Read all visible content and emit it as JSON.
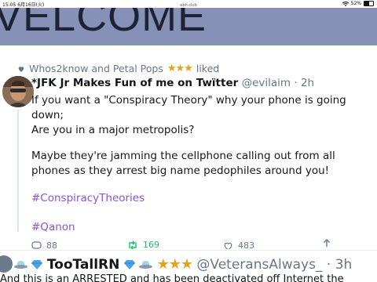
{
  "status_bar": {
    "time": "15:05 6月16日(火)",
    "url": "ebh.club",
    "battery": "52%",
    "battery_level": 0.52
  },
  "banner": {
    "text": "VELCOME"
  },
  "post": {
    "liked_by": "Whos2know and Petal Pops",
    "liked_suffix": "liked",
    "author_name": "*JFK Jr Makes Fun of me on Twïtter",
    "author_handle": "@evilaim",
    "time": "· 2h",
    "paragraphs": [
      "If you want a \"Conspiracy Theory\" why your phone is going down;",
      "Are you in a major metropolis?",
      "Maybe they're jamming the cellphone calling out from all phones as they arrest big name pedophiles around you!"
    ],
    "hashtags": [
      "#ConspiracyTheories",
      "#Qanon"
    ],
    "counts": {
      "replies": "88",
      "reposts": "169",
      "likes": "483"
    }
  },
  "next_post": {
    "author_name": "TooTallRN",
    "author_handle": "@VeteransAlways_",
    "time": "· 3h",
    "snippet": "And this is an ARRESTED and has been deactivated off Internet the"
  },
  "colors": {
    "banner": "#8591b7",
    "hashtag": "#8a56c9",
    "star": "#e7a21b",
    "repost": "#17bf63"
  }
}
